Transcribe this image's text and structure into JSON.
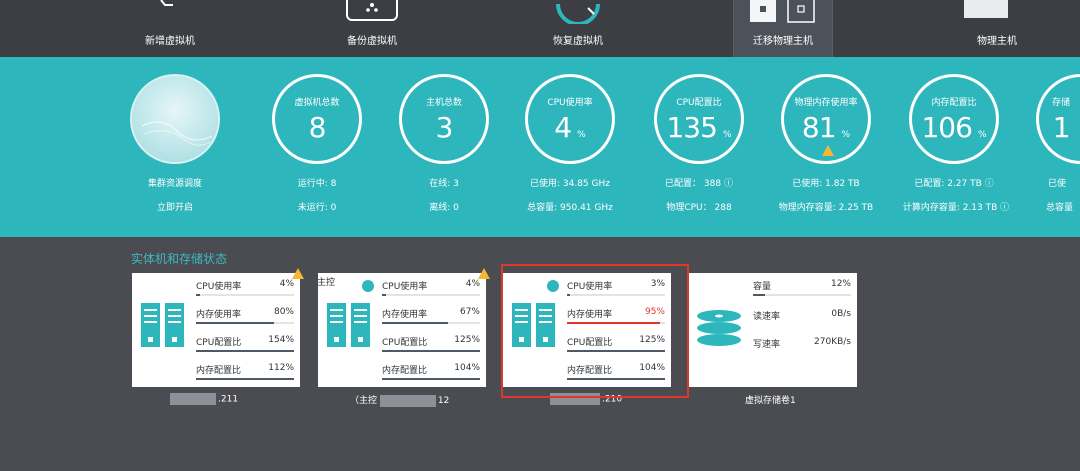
{
  "toolbar": {
    "items": [
      {
        "label": "新增虚拟机",
        "icon": "add-vm-icon"
      },
      {
        "label": "备份虚拟机",
        "icon": "backup-vm-icon"
      },
      {
        "label": "恢复虚拟机",
        "icon": "restore-vm-icon"
      },
      {
        "label": "迁移物理主机",
        "icon": "migrate-host-icon"
      },
      {
        "label": "物理主机",
        "icon": "physical-host-icon"
      }
    ]
  },
  "cluster": {
    "label": "集群资源调度",
    "action": "立即开启"
  },
  "gauges": [
    {
      "title": "虚拟机总数",
      "value": "8",
      "pct": "",
      "line1": "运行中: 8",
      "line2": "未运行: 0"
    },
    {
      "title": "主机总数",
      "value": "3",
      "pct": "",
      "line1": "在线: 3",
      "line2": "离线: 0"
    },
    {
      "title": "CPU使用率",
      "value": "4",
      "pct": "%",
      "line1": "已使用: 34.85 GHz",
      "line2": "总容量: 950.41 GHz"
    },
    {
      "title": "CPU配置比",
      "value": "135",
      "pct": "%",
      "line1": "已配置： 388",
      "line2": "物理CPU： 288"
    },
    {
      "title": "物理内存使用率",
      "value": "81",
      "pct": "%",
      "line1": "已使用: 1.82 TB",
      "line2": "物理内存容量: 2.25 TB"
    },
    {
      "title": "内存配置比",
      "value": "106",
      "pct": "%",
      "line1": "已配置: 2.27 TB",
      "line2": "计算内存容量: 2.13 TB"
    },
    {
      "title": "存储",
      "value": "1",
      "pct": "",
      "line1": "已使",
      "line2": "总容量"
    }
  ],
  "section_title": "实体机和存储状态",
  "hosts": [
    {
      "master": "",
      "caption": ".211",
      "rows": [
        {
          "k": "CPU使用率",
          "v": "4%",
          "p": 0.04
        },
        {
          "k": "内存使用率",
          "v": "80%",
          "p": 0.8
        },
        {
          "k": "CPU配置比",
          "v": "154%",
          "p": 1.0
        },
        {
          "k": "内存配置比",
          "v": "112%",
          "p": 1.0
        }
      ]
    },
    {
      "master": "主控",
      "caption": "（主控",
      "caption2": "12",
      "rows": [
        {
          "k": "CPU使用率",
          "v": "4%",
          "p": 0.04
        },
        {
          "k": "内存使用率",
          "v": "67%",
          "p": 0.67
        },
        {
          "k": "CPU配置比",
          "v": "125%",
          "p": 1.0
        },
        {
          "k": "内存配置比",
          "v": "104%",
          "p": 1.0
        }
      ]
    },
    {
      "master": "",
      "caption": ".210",
      "rows": [
        {
          "k": "CPU使用率",
          "v": "3%",
          "p": 0.03
        },
        {
          "k": "内存使用率",
          "v": "95%",
          "p": 0.95
        },
        {
          "k": "CPU配置比",
          "v": "125%",
          "p": 1.0
        },
        {
          "k": "内存配置比",
          "v": "104%",
          "p": 1.0
        }
      ]
    }
  ],
  "storage": {
    "caption": "虚拟存储卷1",
    "rows": [
      {
        "k": "容量",
        "v": "12%",
        "p": 0.12
      },
      {
        "k": "读速率",
        "v": "0B/s",
        "p": 0
      },
      {
        "k": "写速率",
        "v": "270KB/s",
        "p": 0
      }
    ]
  },
  "colors": {
    "accent": "#2eb6bd",
    "alert": "#e0362b",
    "warning": "#f5b731",
    "dark_bg": "#4a4c52"
  }
}
